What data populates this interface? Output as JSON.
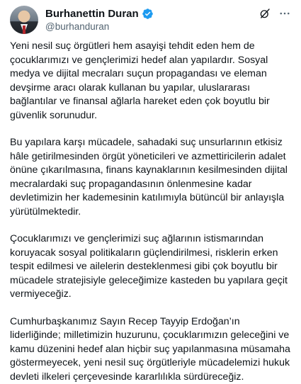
{
  "author": {
    "name": "Burhanettin Duran",
    "handle": "@burhanduran",
    "verified": true,
    "verified_color": "#1d9bf0"
  },
  "header_actions": {
    "grok_icon": "grok-slash-icon",
    "more_icon": "more-horizontal-icon"
  },
  "post": {
    "paragraphs": [
      "Yeni nesil suç örgütleri hem asayişi tehdit eden hem de çocuklarımızı ve gençlerimizi hedef alan yapılardır. Sosyal medya ve dijital mecraları suçun propagandası ve eleman devşirme aracı olarak kullanan bu yapılar, uluslararası bağlantılar ve finansal ağlarla hareket eden çok boyutlu bir güvenlik sorunudur.",
      "Bu yapılara karşı mücadele, sahadaki suç unsurlarının etkisiz hâle getirilmesinden örgüt yöneticileri ve azmettiricilerin adalet önüne çıkarılmasına, finans kaynaklarının kesilmesinden dijital mecralardaki suç propagandasının önlenmesine kadar devletimizin her kademesinin katılımıyla bütüncül bir anlayışla yürütülmektedir.",
      "Çocuklarımızı ve gençlerimizi suç ağlarının istismarından koruyacak sosyal politikaların güçlendirilmesi, risklerin erken tespit edilmesi ve ailelerin desteklenmesi gibi çok boyutlu bir mücadele stratejisiyle geleceğimize kasteden bu yapılara geçit vermiyeceğiz.",
      "Cumhurbaşkanımız Sayın Recep Tayyip Erdoğan’ın liderliğinde; milletimizin huzurunu, çocuklarımızın geleceğini ve kamu düzenini hedef alan hiçbir suç yapılanmasına müsamaha göstermeyecek, yeni nesil suç örgütleriyle mücadelemizi hukuk devleti ilkeleri çerçevesinde kararlılıkla sürdüreceğiz."
    ]
  }
}
